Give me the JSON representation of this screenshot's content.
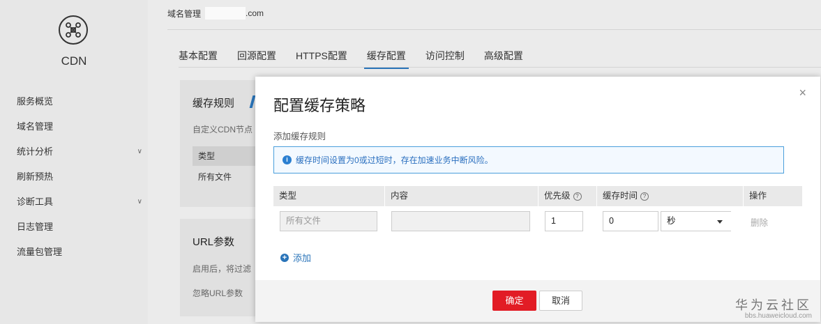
{
  "sidebar": {
    "product": "CDN",
    "items": [
      {
        "label": "服务概览",
        "chevron": false
      },
      {
        "label": "域名管理",
        "chevron": false
      },
      {
        "label": "统计分析",
        "chevron": true
      },
      {
        "label": "刷新预热",
        "chevron": false
      },
      {
        "label": "诊断工具",
        "chevron": true
      },
      {
        "label": "日志管理",
        "chevron": false
      },
      {
        "label": "流量包管理",
        "chevron": false
      }
    ]
  },
  "breadcrumb": {
    "section": "域名管理",
    "domain_suffix": ".com"
  },
  "tabs": [
    "基本配置",
    "回源配置",
    "HTTPS配置",
    "缓存配置",
    "访问控制",
    "高级配置"
  ],
  "active_tab": "缓存配置",
  "card_cache": {
    "title": "缓存规则",
    "desc": "自定义CDN节点",
    "col_type": "类型",
    "row_type": "所有文件"
  },
  "card_url": {
    "title": "URL参数",
    "desc": "启用后，将过滤",
    "field": "忽略URL参数"
  },
  "modal": {
    "title": "配置缓存策略",
    "close": "×",
    "subtitle": "添加缓存规则",
    "info": "缓存时间设置为0或过短时，存在加速业务中断风险。",
    "columns": {
      "type": "类型",
      "content": "内容",
      "priority": "优先级",
      "cache_time": "缓存时间",
      "action": "操作"
    },
    "row": {
      "type_placeholder": "所有文件",
      "content": "",
      "priority": "1",
      "cache_time": "0",
      "unit": "秒",
      "delete": "删除"
    },
    "add": "添加",
    "ok": "确定",
    "cancel": "取消"
  },
  "watermark": {
    "line1": "华为云社区",
    "line2": "bbs.huaweicloud.com"
  },
  "colors": {
    "accent": "#2a74b9",
    "primary_button": "#e21c25",
    "info_border": "#4a9fdc"
  }
}
